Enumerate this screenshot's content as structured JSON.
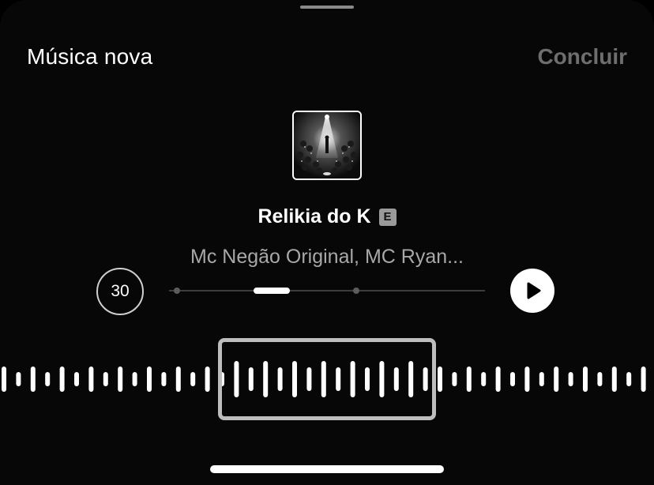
{
  "header": {
    "title": "Música nova",
    "done_label": "Concluir"
  },
  "track": {
    "title": "Relikia do K",
    "explicit_badge": "E",
    "artists": "Mc Negão Original, MC Ryan..."
  },
  "controls": {
    "duration_label": "30",
    "play_icon": "play-icon",
    "progress_fraction": 0.3
  },
  "colors": {
    "background": "#070707",
    "done_disabled": "#6e6e6e",
    "artist_text": "#a8a8a8",
    "accent": "#ffffff"
  }
}
